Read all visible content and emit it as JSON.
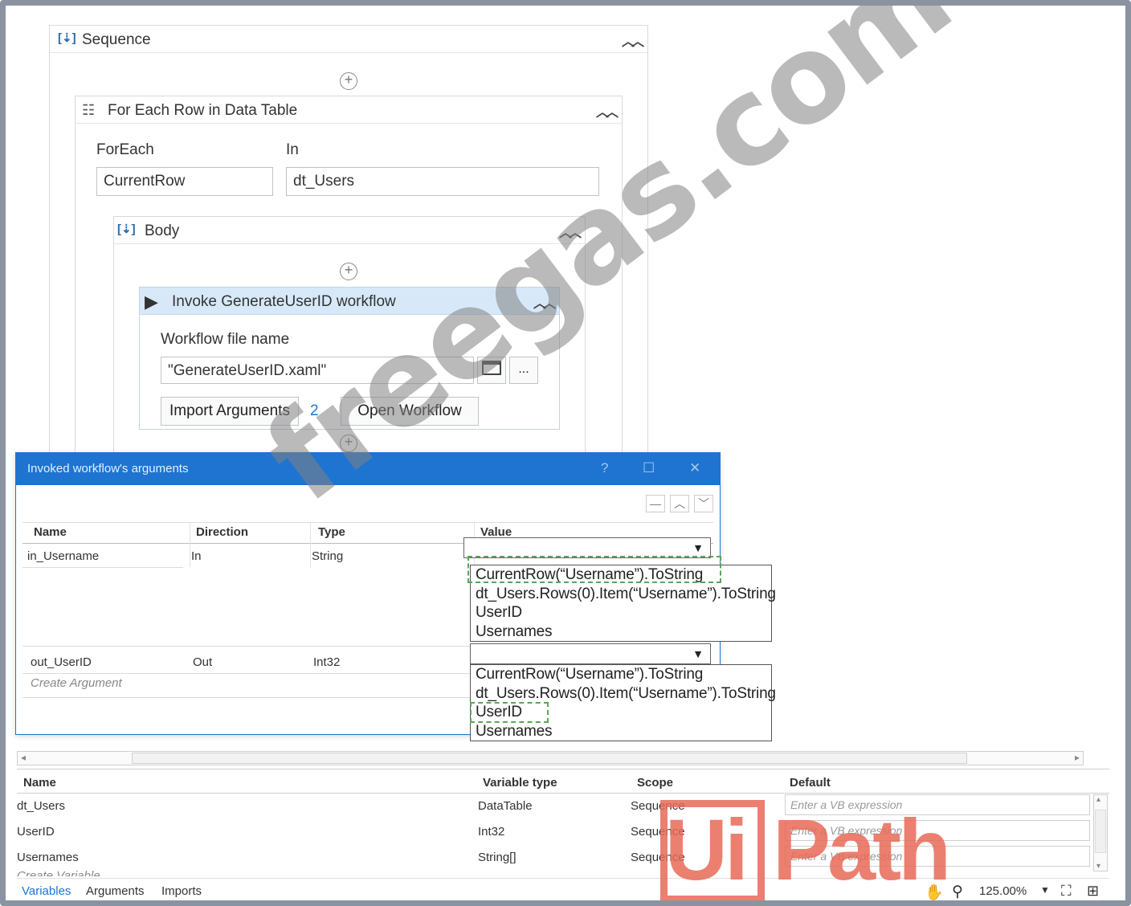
{
  "designer": {
    "sequence": {
      "title": "Sequence"
    },
    "for_each": {
      "title": "For Each Row in Data Table",
      "foreach_label": "ForEach",
      "foreach_value": "CurrentRow",
      "in_label": "In",
      "in_value": "dt_Users"
    },
    "body": {
      "title": "Body"
    },
    "invoke": {
      "title": "Invoke GenerateUserID workflow",
      "file_label": "Workflow file name",
      "file_value": "\"GenerateUserID.xaml\"",
      "ellipsis": "...",
      "import_label": "Import Arguments",
      "import_count": "2",
      "open_label": "Open Workflow"
    }
  },
  "dialog": {
    "title": "Invoked workflow's arguments",
    "help": "?",
    "maximize": "☐",
    "close": "✕",
    "columns": [
      "Name",
      "Direction",
      "Type",
      "Value"
    ],
    "rows": [
      {
        "name": "in_Username",
        "direction": "In",
        "type": "String"
      },
      {
        "name": "out_UserID",
        "direction": "Out",
        "type": "Int32"
      }
    ],
    "create_argument": "Create Argument",
    "options": [
      "CurrentRow(“Username”).ToString",
      "dt_Users.Rows(0).Item(“Username”).ToString",
      "UserID",
      "Usernames"
    ]
  },
  "variables": {
    "columns": [
      "Name",
      "Variable type",
      "Scope",
      "Default"
    ],
    "rows": [
      {
        "name": "dt_Users",
        "type": "DataTable",
        "scope": "Sequence",
        "default": "Enter a VB expression"
      },
      {
        "name": "UserID",
        "type": "Int32",
        "scope": "Sequence",
        "default": "Enter a VB expression"
      },
      {
        "name": "Usernames",
        "type": "String[]",
        "scope": "Sequence",
        "default": "Enter a VB expression"
      }
    ],
    "create_variable": "Create Variable"
  },
  "bottom_tabs": [
    "Variables",
    "Arguments",
    "Imports"
  ],
  "status": {
    "zoom": "125.00%"
  },
  "watermarks": {
    "site": "freegas.com",
    "logo_ui": "Ui",
    "logo_path": "Path"
  },
  "colors": {
    "accent": "#1e74d0",
    "invoke_header": "#d7e9f8",
    "dashed_focus": "#5aa55a",
    "logo": "#e86a58"
  }
}
